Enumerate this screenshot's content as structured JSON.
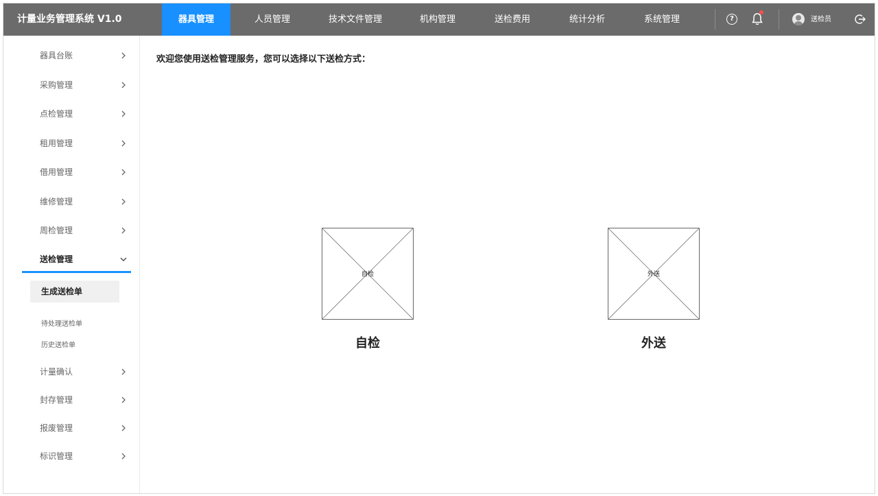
{
  "app": {
    "title": "计量业务管理系统 V1.0"
  },
  "nav": {
    "items": [
      "器具管理",
      "人员管理",
      "技术文件管理",
      "机构管理",
      "送检费用",
      "统计分析",
      "系统管理"
    ],
    "active_index": 0
  },
  "header": {
    "user_name": "送检员",
    "help_glyph": "?",
    "notification_badge_color": "#ff4d4f",
    "accent_color": "#1890ff"
  },
  "sidebar": {
    "items": [
      "器具台账",
      "采购管理",
      "点检管理",
      "租用管理",
      "借用管理",
      "维修管理",
      "周检管理",
      "送检管理",
      "计量确认",
      "封存管理",
      "报废管理",
      "标识管理"
    ],
    "open_index": 7,
    "sub_items": [
      "生成送检单",
      "待处理送检单",
      "历史送检单"
    ],
    "active_sub_index": 0
  },
  "main": {
    "welcome": "欢迎您使用送检管理服务，您可以选择以下送检方式：",
    "options": [
      {
        "inner_label": "自检",
        "caption": "自检"
      },
      {
        "inner_label": "外送",
        "caption": "外送"
      }
    ]
  }
}
